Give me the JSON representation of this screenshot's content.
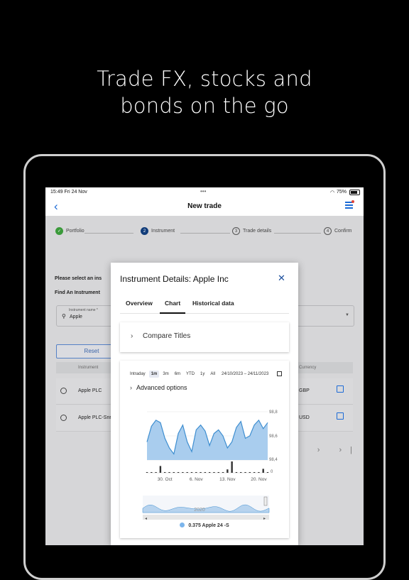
{
  "promo": {
    "line1": "Trade FX, stocks and",
    "line2": "bonds on the go"
  },
  "status": {
    "time": "15:49  Fri 24 Nov",
    "battery": "75%"
  },
  "nav": {
    "title": "New trade",
    "back_glyph": "‹"
  },
  "steps": [
    {
      "num": "✓",
      "label": "Portfolio",
      "state": "done"
    },
    {
      "num": "2",
      "label": "Instrument",
      "state": "active"
    },
    {
      "num": "3",
      "label": "Trade details",
      "state": "todo"
    },
    {
      "num": "4",
      "label": "Confirm",
      "state": "todo"
    }
  ],
  "background": {
    "select_heading": "Please select an ins",
    "find_heading": "Find An Instrument",
    "input_label": "Instrument name *",
    "input_value": "Apple",
    "reset_label": "Reset",
    "col_instrument": "Instrument",
    "col_currency": "Currency",
    "rows": [
      {
        "name": "Apple PLC",
        "currency": "GBP"
      },
      {
        "name": "Apple PLC-Snr",
        "currency": "USD"
      }
    ],
    "pager": "‹ › ›|"
  },
  "modal": {
    "title": "Instrument Details: Apple Inc",
    "close": "✕",
    "tabs": [
      "Overview",
      "Chart",
      "Historical data"
    ],
    "active_tab": "Chart",
    "compare_label": "Compare Titles",
    "advanced_label": "Advanced options",
    "ranges": [
      "Intraday",
      "1m",
      "3m",
      "6m",
      "YTD",
      "1y",
      "All"
    ],
    "selected_range": "1m",
    "date_range": "24/10/2023 – 24/11/2023",
    "legend": "0.375 Apple 24 -S"
  },
  "chart_data": {
    "type": "area",
    "y_labels": [
      "98,8",
      "98,6",
      "98,4"
    ],
    "volume_label": "0",
    "x_ticks": [
      "30. Oct",
      "6. Nov",
      "13. Nov",
      "20. Nov"
    ],
    "navigator_label": "2020",
    "series": [
      {
        "name": "0.375 Apple 24 -S",
        "values": [
          98.55,
          98.68,
          98.73,
          98.71,
          98.58,
          98.5,
          98.45,
          98.62,
          98.69,
          98.55,
          98.47,
          98.65,
          98.69,
          98.64,
          98.52,
          98.62,
          98.65,
          98.6,
          98.5,
          98.55,
          98.67,
          98.72,
          98.58,
          98.6,
          98.69,
          98.73,
          98.66,
          98.71
        ]
      }
    ],
    "volume": [
      0.05,
      0.05,
      0.05,
      0.6,
      0.05,
      0.05,
      0.05,
      0.05,
      0.05,
      0.05,
      0.05,
      0.05,
      0.05,
      0.05,
      0.05,
      0.05,
      0.05,
      0.05,
      0.3,
      1.0,
      0.05,
      0.05,
      0.05,
      0.05,
      0.05,
      0.05,
      0.35,
      0.05
    ],
    "colors": {
      "line": "#3e8ed0",
      "fill": "#a9cdee",
      "volume": "#333333",
      "navigator": "#b7d3ee"
    },
    "grid": true
  }
}
